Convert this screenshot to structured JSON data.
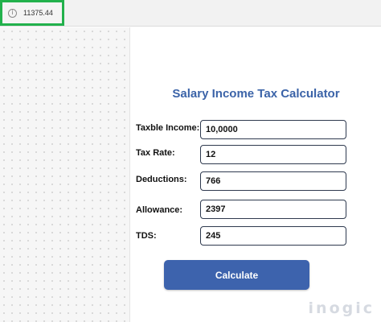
{
  "formula_bar": {
    "icon": "info-icon",
    "value": "11375.44"
  },
  "form": {
    "title": "Salary Income Tax Calculator",
    "fields": [
      {
        "label": "Taxble Income:",
        "value": "10,0000"
      },
      {
        "label": "Tax Rate:",
        "value": "12"
      },
      {
        "label": "Deductions:",
        "value": "766"
      },
      {
        "label": "Allowance:",
        "value": "2397"
      },
      {
        "label": "TDS:",
        "value": "245"
      }
    ],
    "button_label": "Calculate"
  },
  "watermark": "inogic",
  "colors": {
    "title": "#3b63a8",
    "button": "#3d63ad",
    "selection_border": "#22b14c"
  }
}
